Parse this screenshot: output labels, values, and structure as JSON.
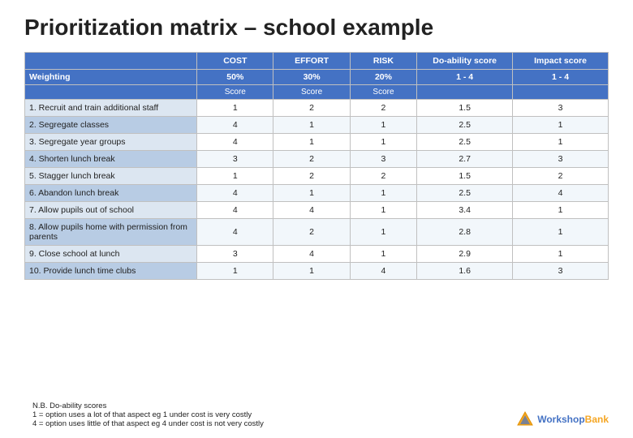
{
  "title": "Prioritization matrix – school example",
  "table": {
    "columns": [
      {
        "id": "label",
        "header": "",
        "subheader": ""
      },
      {
        "id": "cost",
        "header": "COST",
        "subheader": "Score"
      },
      {
        "id": "effort",
        "header": "EFFORT",
        "subheader": "Score"
      },
      {
        "id": "risk",
        "header": "RISK",
        "subheader": "Score"
      },
      {
        "id": "doability",
        "header": "Do-ability score",
        "subheader": ""
      },
      {
        "id": "impact",
        "header": "Impact score",
        "subheader": ""
      }
    ],
    "weighting_label": "Weighting",
    "weightings": [
      "50%",
      "30%",
      "20%",
      "1 - 4",
      "1 - 4"
    ],
    "rows": [
      {
        "label": "1. Recruit and train additional staff",
        "cost": "1",
        "effort": "2",
        "risk": "2",
        "doability": "1.5",
        "impact": "3"
      },
      {
        "label": "2. Segregate classes",
        "cost": "4",
        "effort": "1",
        "risk": "1",
        "doability": "2.5",
        "impact": "1"
      },
      {
        "label": "3. Segregate year groups",
        "cost": "4",
        "effort": "1",
        "risk": "1",
        "doability": "2.5",
        "impact": "1"
      },
      {
        "label": "4. Shorten lunch break",
        "cost": "3",
        "effort": "2",
        "risk": "3",
        "doability": "2.7",
        "impact": "3"
      },
      {
        "label": "5. Stagger lunch break",
        "cost": "1",
        "effort": "2",
        "risk": "2",
        "doability": "1.5",
        "impact": "2"
      },
      {
        "label": "6. Abandon lunch break",
        "cost": "4",
        "effort": "1",
        "risk": "1",
        "doability": "2.5",
        "impact": "4"
      },
      {
        "label": "7. Allow pupils out of school",
        "cost": "4",
        "effort": "4",
        "risk": "1",
        "doability": "3.4",
        "impact": "1"
      },
      {
        "label": "8. Allow pupils home with permission from parents",
        "cost": "4",
        "effort": "2",
        "risk": "1",
        "doability": "2.8",
        "impact": "1"
      },
      {
        "label": "9. Close school at lunch",
        "cost": "3",
        "effort": "4",
        "risk": "1",
        "doability": "2.9",
        "impact": "1"
      },
      {
        "label": "10. Provide lunch time clubs",
        "cost": "1",
        "effort": "1",
        "risk": "4",
        "doability": "1.6",
        "impact": "3"
      }
    ]
  },
  "notes": {
    "line1": "N.B. Do-ability scores",
    "line2": "1 = option uses a lot of that aspect eg 1 under cost is very costly",
    "line3": "4 = option uses little of that aspect eg 4 under cost is not very costly"
  },
  "logo": {
    "text_workshop": "Workshop",
    "text_bank": "Bank"
  }
}
